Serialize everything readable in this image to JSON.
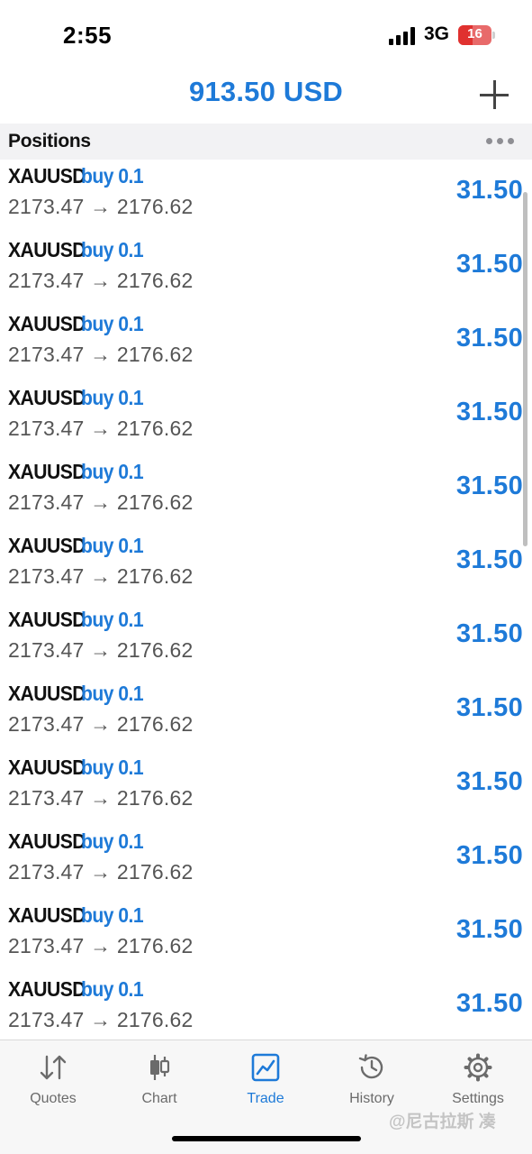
{
  "status_bar": {
    "time": "2:55",
    "network": "3G",
    "battery": "16"
  },
  "header": {
    "balance": "913.50 USD"
  },
  "section": {
    "title": "Positions"
  },
  "positions": [
    {
      "symbol": "XAUUSD",
      "side": "buy 0.1",
      "prices": "2173.47 → 2176.62",
      "profit": "31.50"
    },
    {
      "symbol": "XAUUSD",
      "side": "buy 0.1",
      "prices": "2173.47 → 2176.62",
      "profit": "31.50"
    },
    {
      "symbol": "XAUUSD",
      "side": "buy 0.1",
      "prices": "2173.47 → 2176.62",
      "profit": "31.50"
    },
    {
      "symbol": "XAUUSD",
      "side": "buy 0.1",
      "prices": "2173.47 → 2176.62",
      "profit": "31.50"
    },
    {
      "symbol": "XAUUSD",
      "side": "buy 0.1",
      "prices": "2173.47 → 2176.62",
      "profit": "31.50"
    },
    {
      "symbol": "XAUUSD",
      "side": "buy 0.1",
      "prices": "2173.47 → 2176.62",
      "profit": "31.50"
    },
    {
      "symbol": "XAUUSD",
      "side": "buy 0.1",
      "prices": "2173.47 → 2176.62",
      "profit": "31.50"
    },
    {
      "symbol": "XAUUSD",
      "side": "buy 0.1",
      "prices": "2173.47 → 2176.62",
      "profit": "31.50"
    },
    {
      "symbol": "XAUUSD",
      "side": "buy 0.1",
      "prices": "2173.47 → 2176.62",
      "profit": "31.50"
    },
    {
      "symbol": "XAUUSD",
      "side": "buy 0.1",
      "prices": "2173.47 → 2176.62",
      "profit": "31.50"
    },
    {
      "symbol": "XAUUSD",
      "side": "buy 0.1",
      "prices": "2173.47 → 2176.62",
      "profit": "31.50"
    },
    {
      "symbol": "XAUUSD",
      "side": "buy 0.1",
      "prices": "2173.47 → 2176.62",
      "profit": "31.50"
    }
  ],
  "tabs": [
    {
      "label": "Quotes",
      "icon": "quotes-arrows-icon",
      "active": false
    },
    {
      "label": "Chart",
      "icon": "candlestick-icon",
      "active": false
    },
    {
      "label": "Trade",
      "icon": "trade-chart-icon",
      "active": true
    },
    {
      "label": "History",
      "icon": "history-clock-icon",
      "active": false
    },
    {
      "label": "Settings",
      "icon": "gear-icon",
      "active": false
    }
  ],
  "watermark": "@尼古拉斯 凑",
  "colors": {
    "accent": "#1e7ad8",
    "text": "#111111",
    "secondary_text": "#555555",
    "section_bg": "#f2f2f4",
    "tabbar_bg": "#f7f7f7"
  }
}
